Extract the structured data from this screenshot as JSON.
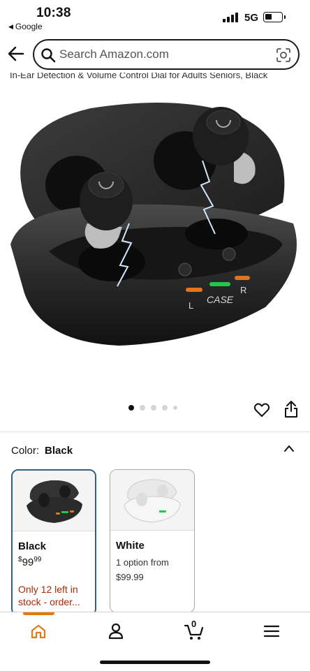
{
  "status": {
    "time": "10:38",
    "back_app": "Google",
    "network": "5G"
  },
  "search": {
    "placeholder": "Search Amazon.com"
  },
  "product": {
    "title_fragment": "In-Ear Detection & Volume Control Dial for Adults Seniors, Black",
    "image_count": 5,
    "active_image": 1,
    "case_labels": {
      "left": "L",
      "center": "CASE",
      "right": "R"
    }
  },
  "color": {
    "label": "Color:",
    "selected": "Black",
    "options": [
      {
        "name": "Black",
        "price_dollars": "99",
        "price_cents": "99",
        "stock": "Only 12 left in stock - order..."
      },
      {
        "name": "White",
        "options_text": "1 option from",
        "price": "$99.99"
      }
    ]
  },
  "nav": {
    "cart_count": "0"
  },
  "colors": {
    "accent": "#e47911",
    "selected_border": "#2f6185",
    "stock_red": "#b12704"
  }
}
